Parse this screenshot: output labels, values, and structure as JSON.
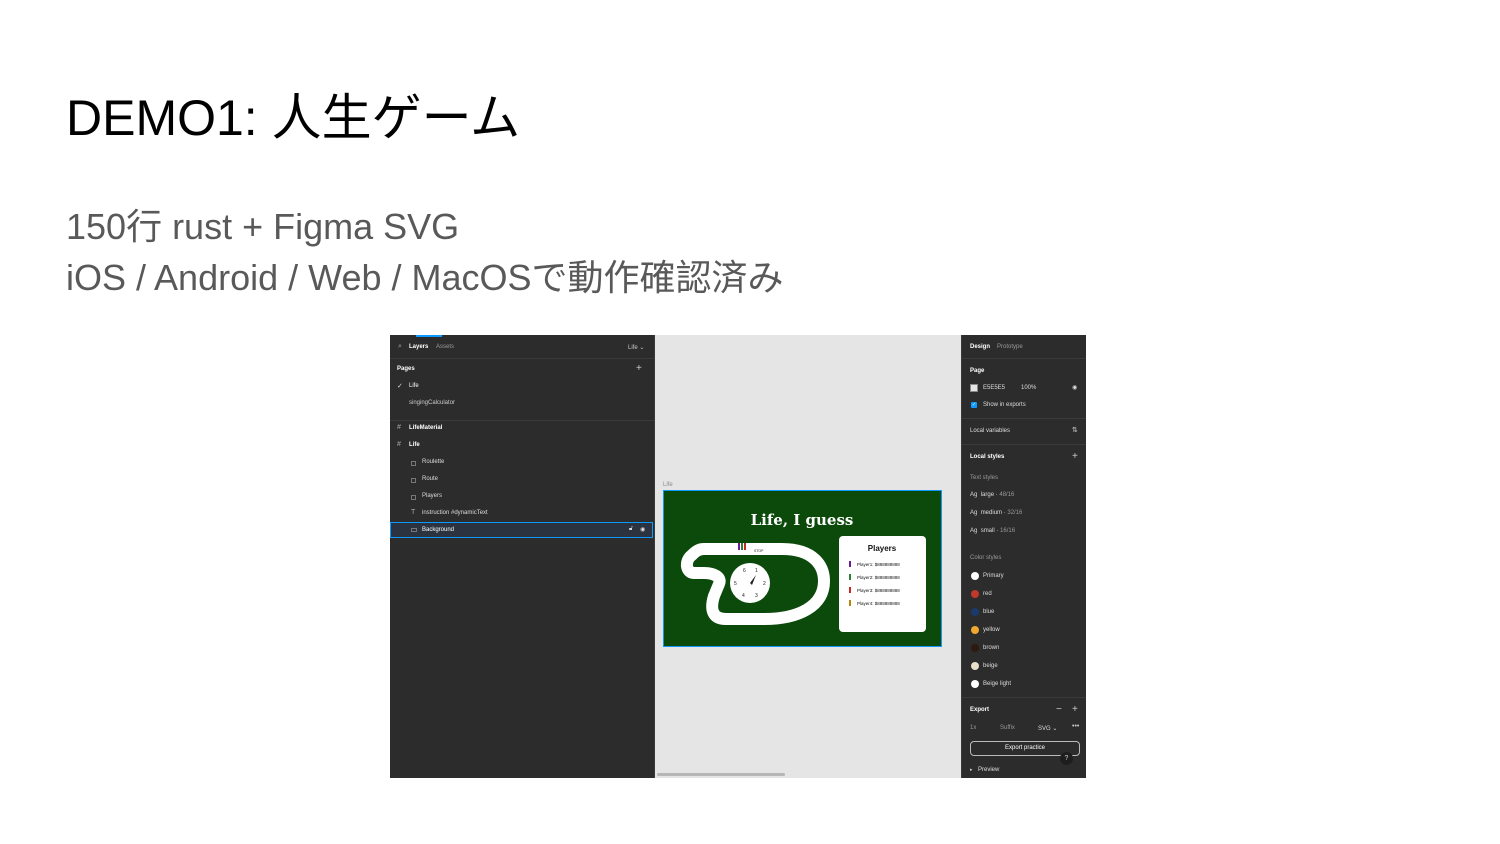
{
  "slide": {
    "title": "DEMO1: 人生ゲーム",
    "subtitle_line1": "150行 rust + Figma SVG",
    "subtitle_line2": "iOS / Android / Web / MacOSで動作確認済み"
  },
  "figma": {
    "layers_panel": {
      "tabs": [
        "Layers",
        "Assets"
      ],
      "current_page_selector": "Life",
      "pages_heading": "Pages",
      "pages": [
        "Life",
        "singingCalculator"
      ],
      "layers": [
        {
          "label": "LifeMaterial",
          "icon": "frame-icon",
          "bold": true
        },
        {
          "label": "Life",
          "icon": "frame-icon",
          "bold": true
        },
        {
          "label": "Roulette",
          "icon": "group-icon"
        },
        {
          "label": "Route",
          "icon": "group-icon"
        },
        {
          "label": "Players",
          "icon": "group-icon"
        },
        {
          "label": "instruction #dynamicText",
          "icon": "text-icon"
        },
        {
          "label": "Background",
          "icon": "rectangle-icon",
          "selected": true
        }
      ]
    },
    "canvas": {
      "frame_label": "Life",
      "game": {
        "title": "Life, I guess",
        "players_heading": "Players",
        "players": [
          {
            "label": "Player1: $888888888",
            "color": "#6a1b9a"
          },
          {
            "label": "Player2: $888888888",
            "color": "#2e7d32"
          },
          {
            "label": "Player3: $888888888",
            "color": "#c62828"
          },
          {
            "label": "Player4: $888888888",
            "color": "#b8860b"
          }
        ],
        "stop_label": "STOP",
        "roulette_numbers": [
          "1",
          "2",
          "3",
          "4",
          "5",
          "6"
        ]
      }
    },
    "design_panel": {
      "tabs": [
        "Design",
        "Prototype"
      ],
      "page_heading": "Page",
      "page_color": "E5E5E5",
      "page_opacity": "100%",
      "show_in_exports": "Show in exports",
      "local_variables": "Local variables",
      "local_styles": "Local styles",
      "text_styles_heading": "Text styles",
      "text_styles": [
        {
          "name": "large",
          "spec": "48/16"
        },
        {
          "name": "medium",
          "spec": "32/16"
        },
        {
          "name": "small",
          "spec": "16/16"
        }
      ],
      "text_style_prefix": "Ag",
      "color_styles_heading": "Color styles",
      "color_styles": [
        {
          "name": "Primary",
          "color": "#ffffff"
        },
        {
          "name": "red",
          "color": "#c0392b"
        },
        {
          "name": "blue",
          "color": "#1a3a6b"
        },
        {
          "name": "yellow",
          "color": "#f0a830"
        },
        {
          "name": "brown",
          "color": "#2a1a10"
        },
        {
          "name": "beige",
          "color": "#e8e0cc"
        },
        {
          "name": "Beige light",
          "color": "#ffffff"
        }
      ],
      "export_heading": "Export",
      "export_scale": "1x",
      "export_suffix": "Suffix",
      "export_format": "SVG",
      "export_button": "Export practice",
      "preview": "Preview"
    }
  }
}
